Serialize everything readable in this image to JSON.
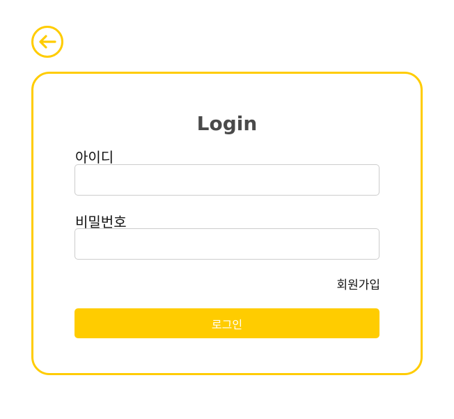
{
  "colors": {
    "accent": "#FFCC00",
    "title_text": "#4a4a4a",
    "input_border": "#cccccc",
    "button_text": "#ffffff"
  },
  "header": {
    "back_icon": "arrow-left-icon"
  },
  "login_form": {
    "title": "Login",
    "id_label": "아이디",
    "id_value": "",
    "id_placeholder": "",
    "password_label": "비밀번호",
    "password_value": "",
    "password_placeholder": "",
    "signup_link": "회원가입",
    "submit_label": "로그인"
  }
}
